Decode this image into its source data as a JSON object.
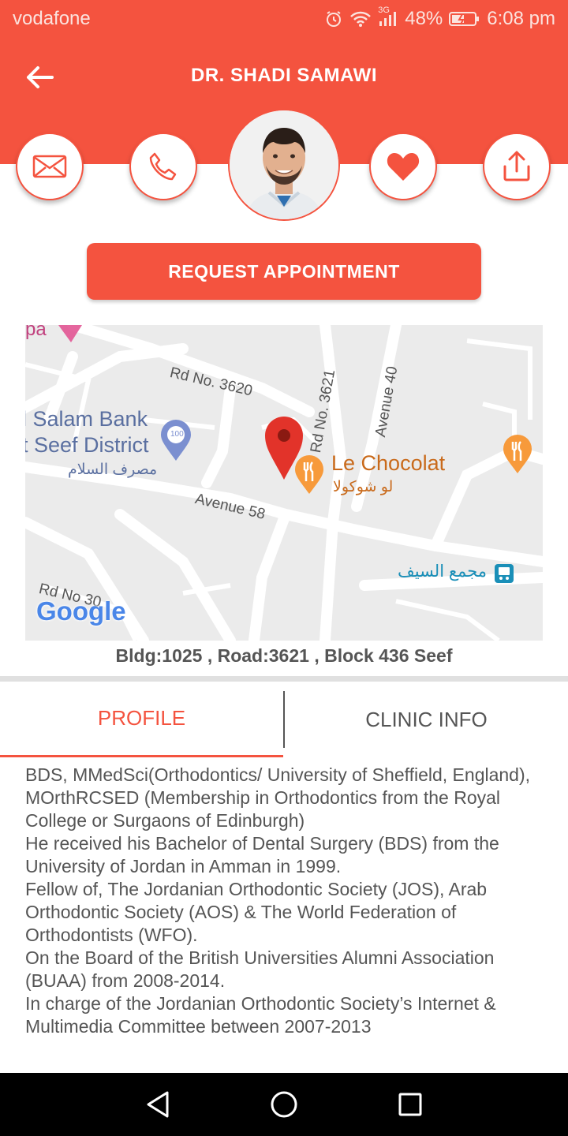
{
  "status_bar": {
    "carrier": "vodafone",
    "network": "3G",
    "battery": "48%",
    "time": "6:08 pm"
  },
  "header": {
    "title": "DR. SHADI SAMAWI"
  },
  "actions": {
    "appointment_label": "REQUEST APPOINTMENT"
  },
  "map": {
    "labels": {
      "rd3620": "Rd No. 3620",
      "rd3621": "Rd No. 3621",
      "avenue40": "Avenue 40",
      "avenue58": "Avenue 58",
      "bank_line1": "l Salam Bank",
      "bank_line2": "t Seef District",
      "bank_ar": "مصرف السلام",
      "chocolat": "Le Chocolat",
      "chocolat_ar": "لو شوكولا",
      "mall_ar": "مجمع السيف",
      "rd3020": "Rd No 30",
      "partial_top": "pa",
      "badge_100": "100"
    },
    "google_logo": "Google"
  },
  "address": "Bldg:1025 , Road:3621 , Block 436 Seef",
  "tabs": [
    {
      "label": "PROFILE",
      "active": true
    },
    {
      "label": "CLINIC INFO",
      "active": false
    }
  ],
  "profile": {
    "paragraphs": [
      "BDS, MMedSci(Orthodontics/ University of Sheffield, England), MOrthRCSED (Membership in Orthodontics from the Royal College or Surgaons of Edinburgh)",
      "He received his Bachelor of Dental Surgery (BDS) from the University of Jordan in Amman in 1999.",
      "Fellow of, The Jordanian Orthodontic Society (JOS), Arab Orthodontic Society (AOS) & The World Federation of Orthodontists (WFO).",
      "On the Board of the British Universities Alumni Association (BUAA) from 2008-2014.",
      "In charge of the Jordanian Orthodontic Society’s Internet & Multimedia Committee between 2007-2013"
    ]
  },
  "colors": {
    "accent": "#f4533f",
    "text": "#555555"
  }
}
